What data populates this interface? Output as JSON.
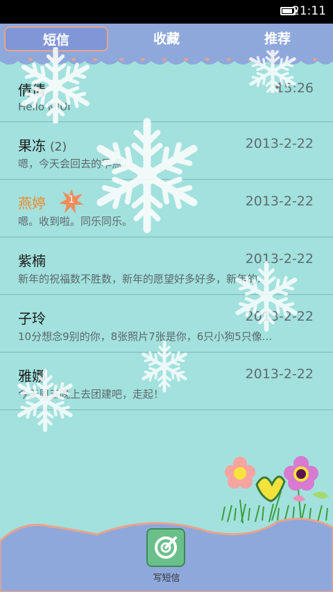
{
  "status": {
    "time": "21:11",
    "battery_level": 0.8
  },
  "tabs": [
    {
      "label": "短信",
      "active": true
    },
    {
      "label": "收藏",
      "active": false
    },
    {
      "label": "推荐",
      "active": false
    }
  ],
  "conversations": [
    {
      "name": "倩倩",
      "count": "",
      "date": "15:26",
      "preview": "Hello MIUI",
      "unread": false,
      "badge": "",
      "draft": true
    },
    {
      "name": "果冻",
      "count": "(2)",
      "date": "2013-2-22",
      "preview": "嗯，今天会回去的早点。",
      "unread": false,
      "badge": "",
      "draft": false
    },
    {
      "name": "燕婷",
      "count": "",
      "date": "2013-2-22",
      "preview": "嗯。收到啦。同乐同乐。",
      "unread": true,
      "badge": "1",
      "draft": false
    },
    {
      "name": "紫楠",
      "count": "",
      "date": "2013-2-22",
      "preview": "新年的祝福数不胜数，新年的愿望好多好多，新年的...",
      "unread": false,
      "badge": "",
      "draft": false
    },
    {
      "name": "子玲",
      "count": "",
      "date": "2013-2-22",
      "preview": "10分想念9别的你，8张照片7张是你，6只小狗5只像...",
      "unread": false,
      "badge": "",
      "draft": false
    },
    {
      "name": "雅娜",
      "count": "",
      "date": "2013-2-22",
      "preview": "今天周五晚上去团建吧，走起！",
      "unread": false,
      "badge": "",
      "draft": false
    }
  ],
  "compose": {
    "label": "写短信"
  },
  "colors": {
    "background": "#a2e1dd",
    "tabbar": "#8fa8dc",
    "unread_name": "#ee8a2f",
    "compose": "#6abf8a"
  }
}
